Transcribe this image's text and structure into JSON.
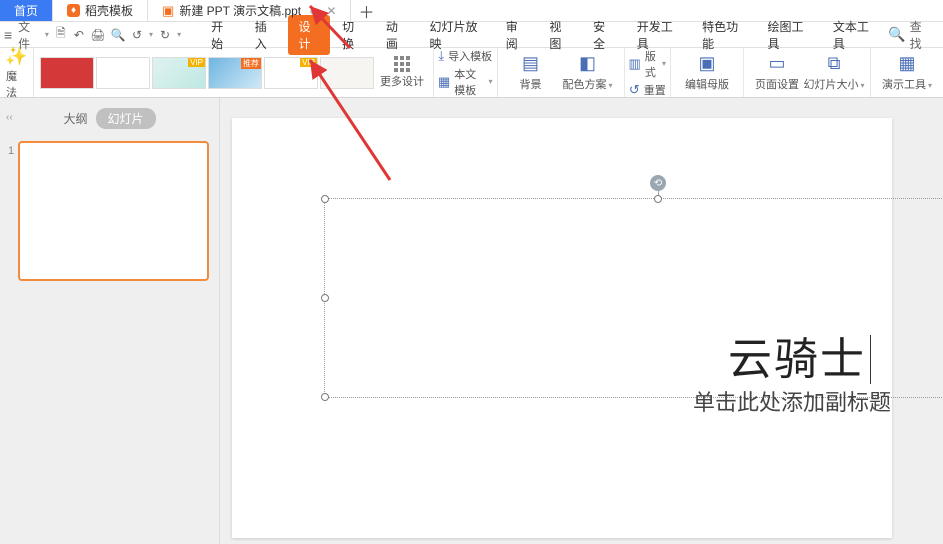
{
  "tabs": {
    "home": "首页",
    "docker": "稻壳模板",
    "docTitle": "新建 PPT 演示文稿.ppt"
  },
  "menubar": {
    "file": "文件",
    "items": [
      "开始",
      "插入",
      "设计",
      "切换",
      "动画",
      "幻灯片放映",
      "审阅",
      "视图",
      "安全",
      "开发工具",
      "特色功能",
      "绘图工具",
      "文本工具"
    ],
    "activeIndex": 2,
    "search": "查找"
  },
  "ribbon": {
    "magic": "魔法",
    "moreDesign": "更多设计",
    "importTpl": "导入模板",
    "thisTpl": "本文模板",
    "background": "背景",
    "colorScheme": "配色方案",
    "layout": "版式",
    "reset": "重置",
    "editMaster": "编辑母版",
    "pageSetup": "页面设置",
    "slideSize": "幻灯片大小",
    "presentTools": "演示工具",
    "vipBadge": "VIP",
    "hotBadge": "推荐"
  },
  "sidebar": {
    "outline": "大纲",
    "slides": "幻灯片",
    "slideNumber": "1"
  },
  "slide": {
    "title": "云骑士",
    "subtitle": "单击此处添加副标题"
  }
}
